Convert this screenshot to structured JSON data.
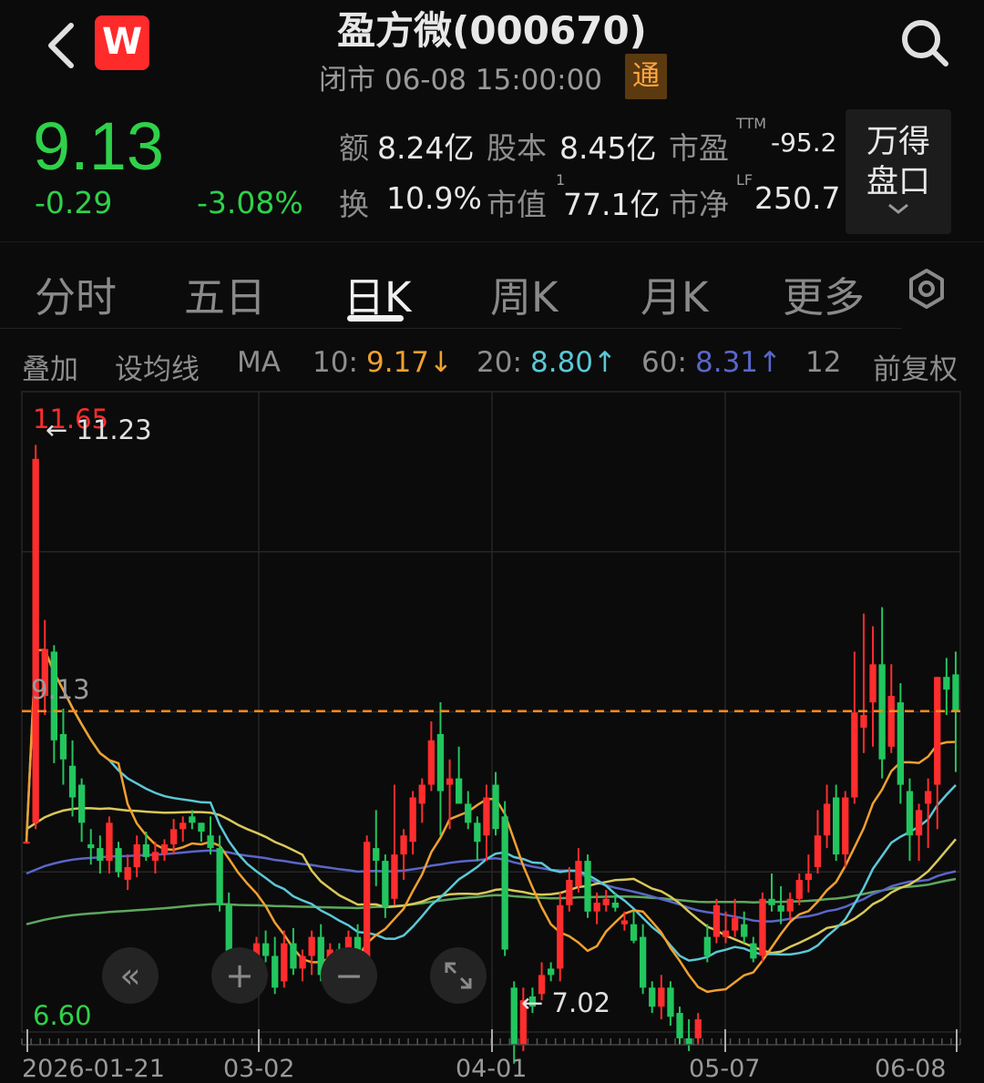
{
  "header": {
    "title": "盈方微(000670)",
    "status": "闭市 06-08 15:00:00",
    "badge": "通",
    "logo_text": "W"
  },
  "quote": {
    "price": "9.13",
    "change": "-0.29",
    "change_pct": "-3.08%"
  },
  "stats": {
    "amount_label": "额",
    "amount_value": "8.24亿",
    "share_label": "股本",
    "share_value": "8.45亿",
    "pe_label": "市盈",
    "pe_sup": "TTM",
    "pe_value": "-95.2",
    "turnover_label": "换",
    "turnover_value": "10.9%",
    "mcap_label": "市值",
    "mcap_sup": "1",
    "mcap_value": "77.1亿",
    "pb_label": "市净",
    "pb_sup": "LF",
    "pb_value": "250.7"
  },
  "pankou": {
    "line1": "万得",
    "line2": "盘口"
  },
  "tabs": [
    "分时",
    "五日",
    "日K",
    "周K",
    "月K",
    "更多"
  ],
  "active_tab": 2,
  "ma_bar": {
    "overlay": "叠加",
    "set_ma": "设均线",
    "ma": "MA",
    "ma10_label": "10:",
    "ma10_value": "9.17↓",
    "ma20_label": "20:",
    "ma20_value": "8.80↑",
    "ma60_label": "60:",
    "ma60_value": "8.31↑",
    "count": "12",
    "adjust": "前复权"
  },
  "colors": {
    "up": "#ff2d2d",
    "down": "#22c55e",
    "ma10": "#f0a030",
    "ma20": "#5bc8d6",
    "ma60": "#5a66c8",
    "ma_yellow": "#d9c85a",
    "ma_green": "#5ea85e",
    "price_line": "#ff8c1a"
  },
  "chart_data": {
    "type": "candlestick",
    "ylim": [
      6.6,
      11.65
    ],
    "y_top_label": "11.65",
    "y_bottom_label": "6.60",
    "current_price_label": "9.13",
    "high_marker": "11.23",
    "low_marker": "7.02",
    "dates": [
      "2026-01-21",
      "03-02",
      "04-01",
      "05-07",
      "06-08"
    ],
    "current_price": 9.13,
    "candles": [
      [
        8.1,
        8.1,
        8.1,
        8.1
      ],
      [
        8.25,
        11.23,
        8.2,
        11.12
      ],
      [
        9.25,
        9.85,
        9.1,
        9.62
      ],
      [
        9.6,
        9.65,
        8.72,
        8.9
      ],
      [
        8.95,
        9.15,
        8.55,
        8.75
      ],
      [
        8.7,
        8.9,
        8.3,
        8.45
      ],
      [
        8.55,
        8.6,
        8.1,
        8.25
      ],
      [
        8.08,
        8.2,
        7.92,
        8.05
      ],
      [
        8.05,
        8.15,
        7.85,
        7.95
      ],
      [
        7.95,
        8.3,
        7.85,
        8.25
      ],
      [
        8.05,
        8.1,
        7.82,
        7.86
      ],
      [
        7.8,
        8.0,
        7.72,
        7.9
      ],
      [
        7.9,
        8.15,
        7.82,
        8.08
      ],
      [
        8.08,
        8.18,
        7.95,
        7.98
      ],
      [
        7.95,
        8.1,
        7.85,
        8.02
      ],
      [
        8.0,
        8.12,
        7.95,
        8.08
      ],
      [
        8.08,
        8.28,
        8.0,
        8.2
      ],
      [
        8.2,
        8.3,
        8.1,
        8.25
      ],
      [
        8.3,
        8.35,
        8.2,
        8.25
      ],
      [
        8.25,
        8.25,
        8.1,
        8.18
      ],
      [
        8.15,
        8.3,
        8.0,
        8.05
      ],
      [
        8.05,
        8.15,
        7.55,
        7.6
      ],
      [
        7.6,
        7.7,
        6.95,
        7.05
      ],
      [
        7.0,
        7.15,
        6.85,
        6.9
      ],
      [
        7.05,
        7.2,
        6.95,
        7.15
      ],
      [
        7.15,
        7.35,
        7.05,
        7.3
      ],
      [
        7.3,
        7.4,
        7.15,
        7.2
      ],
      [
        7.2,
        7.35,
        6.9,
        6.95
      ],
      [
        7.0,
        7.4,
        6.95,
        7.3
      ],
      [
        7.3,
        7.42,
        7.05,
        7.1
      ],
      [
        7.1,
        7.25,
        7.0,
        7.2
      ],
      [
        7.2,
        7.4,
        7.05,
        7.35
      ],
      [
        7.35,
        7.45,
        7.0,
        7.05
      ],
      [
        7.0,
        7.3,
        6.95,
        7.25
      ],
      [
        7.25,
        7.3,
        7.05,
        7.15
      ],
      [
        7.15,
        7.4,
        7.1,
        7.35
      ],
      [
        7.35,
        7.45,
        7.1,
        7.15
      ],
      [
        7.15,
        8.15,
        7.1,
        8.1
      ],
      [
        8.05,
        8.35,
        7.75,
        7.95
      ],
      [
        7.95,
        8.0,
        7.5,
        7.58
      ],
      [
        7.65,
        8.55,
        7.6,
        8.0
      ],
      [
        8.0,
        8.2,
        7.8,
        8.15
      ],
      [
        8.1,
        8.5,
        8.0,
        8.45
      ],
      [
        8.4,
        8.6,
        8.25,
        8.55
      ],
      [
        8.55,
        9.05,
        8.5,
        8.9
      ],
      [
        8.95,
        9.2,
        8.15,
        8.5
      ],
      [
        8.55,
        8.75,
        8.2,
        8.6
      ],
      [
        8.6,
        8.85,
        8.45,
        8.4
      ],
      [
        8.4,
        8.5,
        8.2,
        8.25
      ],
      [
        8.25,
        8.3,
        7.95,
        8.1
      ],
      [
        8.15,
        8.55,
        7.95,
        8.45
      ],
      [
        8.55,
        8.65,
        8.15,
        8.2
      ],
      [
        8.3,
        8.42,
        7.2,
        7.25
      ],
      [
        6.95,
        7.0,
        6.35,
        6.5
      ],
      [
        6.5,
        6.95,
        6.45,
        6.85
      ],
      [
        6.88,
        6.95,
        6.75,
        6.8
      ],
      [
        6.9,
        7.15,
        6.85,
        7.05
      ],
      [
        7.1,
        7.15,
        7.0,
        7.05
      ],
      [
        7.1,
        7.7,
        7.0,
        7.6
      ],
      [
        7.6,
        7.9,
        7.55,
        7.8
      ],
      [
        7.75,
        8.05,
        7.7,
        7.95
      ],
      [
        7.95,
        8.0,
        7.5,
        7.55
      ],
      [
        7.55,
        7.7,
        7.45,
        7.62
      ],
      [
        7.6,
        7.72,
        7.55,
        7.65
      ],
      [
        7.62,
        7.7,
        7.55,
        7.58
      ],
      [
        7.45,
        7.55,
        7.4,
        7.48
      ],
      [
        7.45,
        7.55,
        7.3,
        7.32
      ],
      [
        7.35,
        7.45,
        6.9,
        6.95
      ],
      [
        6.95,
        7.0,
        6.75,
        6.8
      ],
      [
        6.8,
        7.05,
        6.7,
        6.95
      ],
      [
        6.95,
        7.0,
        6.65,
        6.72
      ],
      [
        6.75,
        6.8,
        6.5,
        6.55
      ],
      [
        6.55,
        6.7,
        6.45,
        6.5
      ],
      [
        6.55,
        6.75,
        6.5,
        6.7
      ],
      [
        7.35,
        7.45,
        7.15,
        7.2
      ],
      [
        7.35,
        7.65,
        7.3,
        7.6
      ],
      [
        7.35,
        7.55,
        7.3,
        7.4
      ],
      [
        7.4,
        7.65,
        7.35,
        7.5
      ],
      [
        7.45,
        7.55,
        7.3,
        7.35
      ],
      [
        7.3,
        7.35,
        7.15,
        7.18
      ],
      [
        7.2,
        7.7,
        7.15,
        7.65
      ],
      [
        7.65,
        7.85,
        7.55,
        7.6
      ],
      [
        7.6,
        7.75,
        7.45,
        7.55
      ],
      [
        7.55,
        7.7,
        7.48,
        7.65
      ],
      [
        7.65,
        7.85,
        7.6,
        7.8
      ],
      [
        7.8,
        8.0,
        7.7,
        7.85
      ],
      [
        7.9,
        8.35,
        7.85,
        8.15
      ],
      [
        8.15,
        8.55,
        8.05,
        8.4
      ],
      [
        8.45,
        8.55,
        7.95,
        8.0
      ],
      [
        8.0,
        8.5,
        7.9,
        8.45
      ],
      [
        8.45,
        9.6,
        8.4,
        9.12
      ],
      [
        9.0,
        9.9,
        8.8,
        9.1
      ],
      [
        9.2,
        9.8,
        8.85,
        9.5
      ],
      [
        9.5,
        9.95,
        8.6,
        8.75
      ],
      [
        8.85,
        9.5,
        8.8,
        9.25
      ],
      [
        9.2,
        9.35,
        8.4,
        8.55
      ],
      [
        8.5,
        8.6,
        7.95,
        8.15
      ],
      [
        8.15,
        8.4,
        7.95,
        8.35
      ],
      [
        8.4,
        8.6,
        8.05,
        8.5
      ],
      [
        8.55,
        9.4,
        8.2,
        9.4
      ],
      [
        9.4,
        9.55,
        9.1,
        9.3
      ],
      [
        9.42,
        9.6,
        8.65,
        9.13
      ]
    ]
  }
}
